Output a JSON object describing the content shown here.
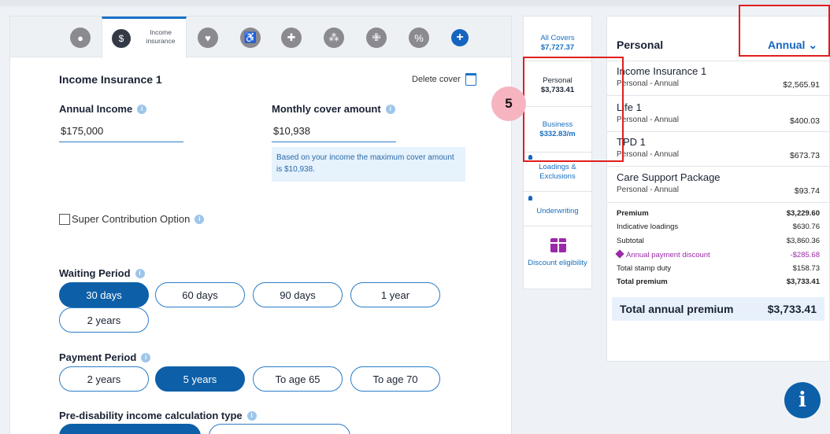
{
  "tabs": [
    {
      "icon": "person-icon"
    },
    {
      "icon": "income-insurance-icon",
      "label": "Income insurance",
      "active": true
    },
    {
      "icon": "heart-icon"
    },
    {
      "icon": "wheelchair-icon"
    },
    {
      "icon": "plus-icon"
    },
    {
      "icon": "crutches-icon"
    },
    {
      "icon": "medical-kit-icon"
    },
    {
      "icon": "percent-hand-icon"
    },
    {
      "icon": "add-cover-icon",
      "label": "+"
    }
  ],
  "form": {
    "title": "Income Insurance 1",
    "delete_label": "Delete cover",
    "annual_income_label": "Annual Income",
    "annual_income_value": "$175,000",
    "monthly_cover_label": "Monthly cover amount",
    "monthly_cover_value": "$10,938",
    "hint_text": "Based on your income the maximum cover amount is $10,938.",
    "super_option_label": "Super Contribution Option",
    "waiting_period_label": "Waiting Period",
    "waiting_period_options": [
      "30 days",
      "60 days",
      "90 days",
      "1 year",
      "2 years"
    ],
    "waiting_period_selected": "30 days",
    "payment_period_label": "Payment Period",
    "payment_period_options": [
      "2 years",
      "5 years",
      "To age 65",
      "To age 70"
    ],
    "payment_period_selected": "5 years",
    "pre_disability_label": "Pre-disability income calculation type"
  },
  "nav": {
    "all_covers_label": "All Covers",
    "all_covers_amount": "$7,727.37",
    "personal_label": "Personal",
    "personal_amount": "$3,733.41",
    "business_label": "Business",
    "business_amount": "$332.83/m",
    "loadings_label": "Loadings & Exclusions",
    "underwriting_label": "Underwriting",
    "discount_label": "Discount eligibility"
  },
  "summary": {
    "title": "Personal",
    "frequency": "Annual",
    "covers": [
      {
        "name": "Income Insurance 1",
        "sub": "Personal - Annual",
        "amount": "$2,565.91"
      },
      {
        "name": "Life 1",
        "sub": "Personal - Annual",
        "amount": "$400.03"
      },
      {
        "name": "TPD 1",
        "sub": "Personal - Annual",
        "amount": "$673.73"
      },
      {
        "name": "Care Support Package",
        "sub": "Personal - Annual",
        "amount": "$93.74"
      }
    ],
    "breakdown": [
      {
        "label": "Premium",
        "value": "$3,229.60"
      },
      {
        "label": "Indicative loadings",
        "value": "$630.76"
      },
      {
        "label": "Subtotal",
        "value": "$3,860.36"
      },
      {
        "label": "Annual payment discount",
        "value": "-$285.68"
      },
      {
        "label": "Total stamp duty",
        "value": "$158.73"
      },
      {
        "label": "Total premium",
        "value": "$3,733.41"
      }
    ],
    "total_label": "Total annual premium",
    "total_value": "$3,733.41"
  },
  "annotation": {
    "step": "5"
  },
  "colors": {
    "primary": "#0d5fa8",
    "accent": "#1565c0",
    "discount": "#9b2aa8",
    "highlight": "#e01e1e"
  }
}
